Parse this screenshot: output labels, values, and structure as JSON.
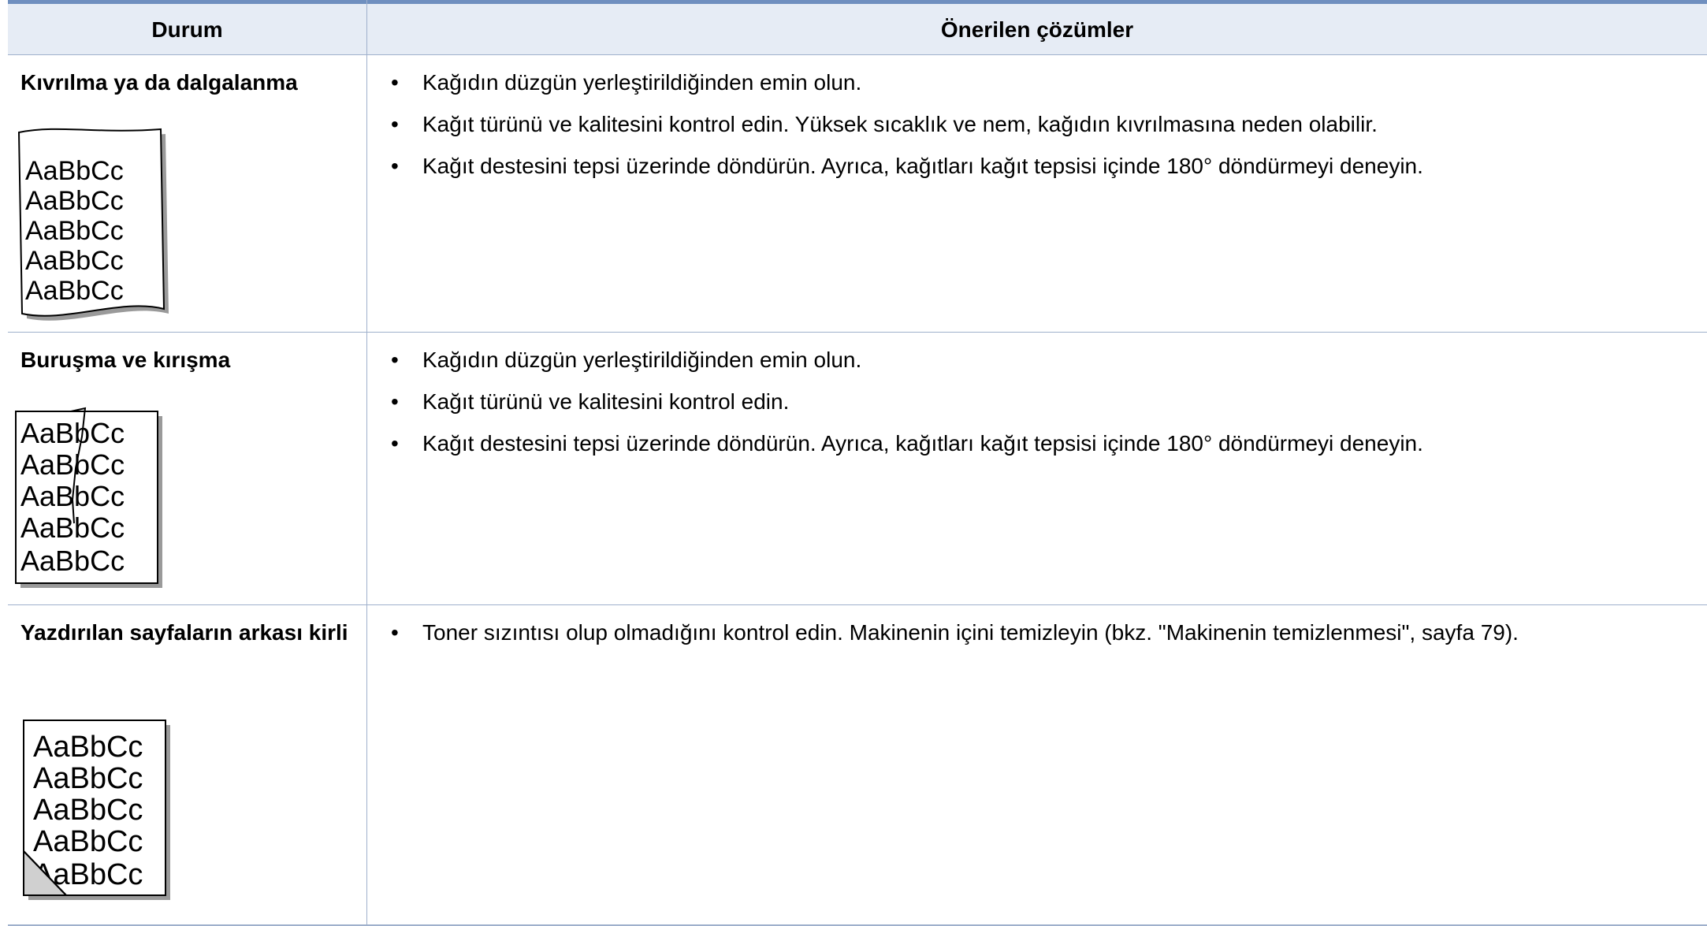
{
  "header": {
    "condition": "Durum",
    "solutions": "Önerilen çözümler"
  },
  "rows": [
    {
      "condition": "Kıvrılma ya da dalgalanma",
      "illustration": "curled-paper-sample",
      "sample_text": "AaBbCc",
      "solutions": [
        "Kağıdın düzgün yerleştirildiğinden emin olun.",
        "Kağıt türünü ve kalitesini kontrol edin. Yüksek sıcaklık ve nem, kağıdın kıvrılmasına neden olabilir.",
        "Kağıt destesini tepsi üzerinde döndürün. Ayrıca, kağıtları kağıt tepsisi içinde 180° döndürmeyi deneyin."
      ]
    },
    {
      "condition": "Buruşma ve kırışma",
      "illustration": "wrinkled-paper-sample",
      "sample_text": "AaBbCc",
      "solutions": [
        "Kağıdın düzgün yerleştirildiğinden emin olun.",
        "Kağıt türünü ve kalitesini kontrol edin.",
        "Kağıt destesini tepsi üzerinde döndürün. Ayrıca, kağıtları kağıt tepsisi içinde 180° döndürmeyi deneyin."
      ]
    },
    {
      "condition": "Yazdırılan sayfaların arkası kirli",
      "illustration": "dirty-back-paper-sample",
      "sample_text": "AaBbCc",
      "solutions": [
        "Toner sızıntısı olup olmadığını kontrol edin. Makinenin içini temizleyin (bkz. \"Makinenin temizlenmesi\", sayfa 79)."
      ]
    }
  ],
  "bullet": "•"
}
